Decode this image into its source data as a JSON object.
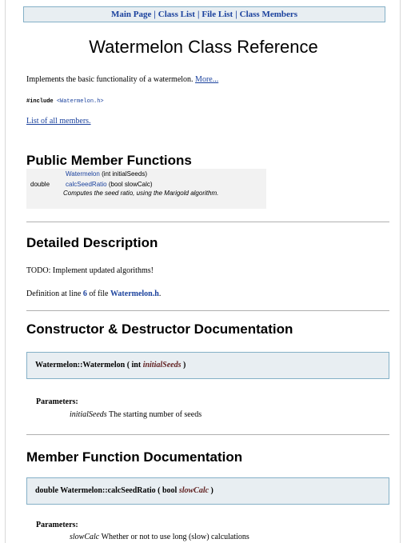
{
  "nav": {
    "items": [
      "Main Page",
      "Class List",
      "File List",
      "Class Members"
    ],
    "separator": "|"
  },
  "title": "Watermelon Class Reference",
  "brief": {
    "text": "Implements the basic functionality of a watermelon.",
    "more_link": "More..."
  },
  "include": {
    "directive": "#include",
    "file": "<Watermelon.h>"
  },
  "members_link": "List of all members.",
  "public_member_functions": {
    "heading": "Public Member Functions",
    "rows": [
      {
        "return_type": "",
        "name": "Watermelon",
        "params": "(int initialSeeds)",
        "description": ""
      },
      {
        "return_type": "double",
        "name": "calcSeedRatio",
        "params": "(bool slowCalc)",
        "description": "Computes the seed ratio, using the Marigold algorithm."
      }
    ]
  },
  "detailed_description": {
    "heading": "Detailed Description",
    "todo": "TODO: Implement updated algorithms!",
    "definition_prefix": "Definition at line",
    "line": "6",
    "definition_mid": "of file",
    "file": "Watermelon.h",
    "definition_suffix": "."
  },
  "constructor_section": {
    "heading": "Constructor & Destructor Documentation",
    "signature_prefix": "Watermelon::Watermelon ( int",
    "param_name": "initialSeeds",
    "signature_suffix": ")",
    "parameters_label": "Parameters:",
    "param_desc_name": "initialSeeds",
    "param_desc": "The starting number of seeds"
  },
  "member_function_section": {
    "heading": "Member Function Documentation",
    "signature_prefix": "double Watermelon::calcSeedRatio ( bool",
    "param_name": "slowCalc",
    "signature_suffix": ")",
    "parameters_label": "Parameters:",
    "param_desc_name": "slowCalc",
    "param_desc": "Whether or not to use long (slow) calculations"
  },
  "colors": {
    "link": "#1a419d",
    "nav_background": "#e8eef2",
    "nav_border": "#84b0c7",
    "param_emphasis": "#602020",
    "member_table_background": "#f2f2f2"
  }
}
